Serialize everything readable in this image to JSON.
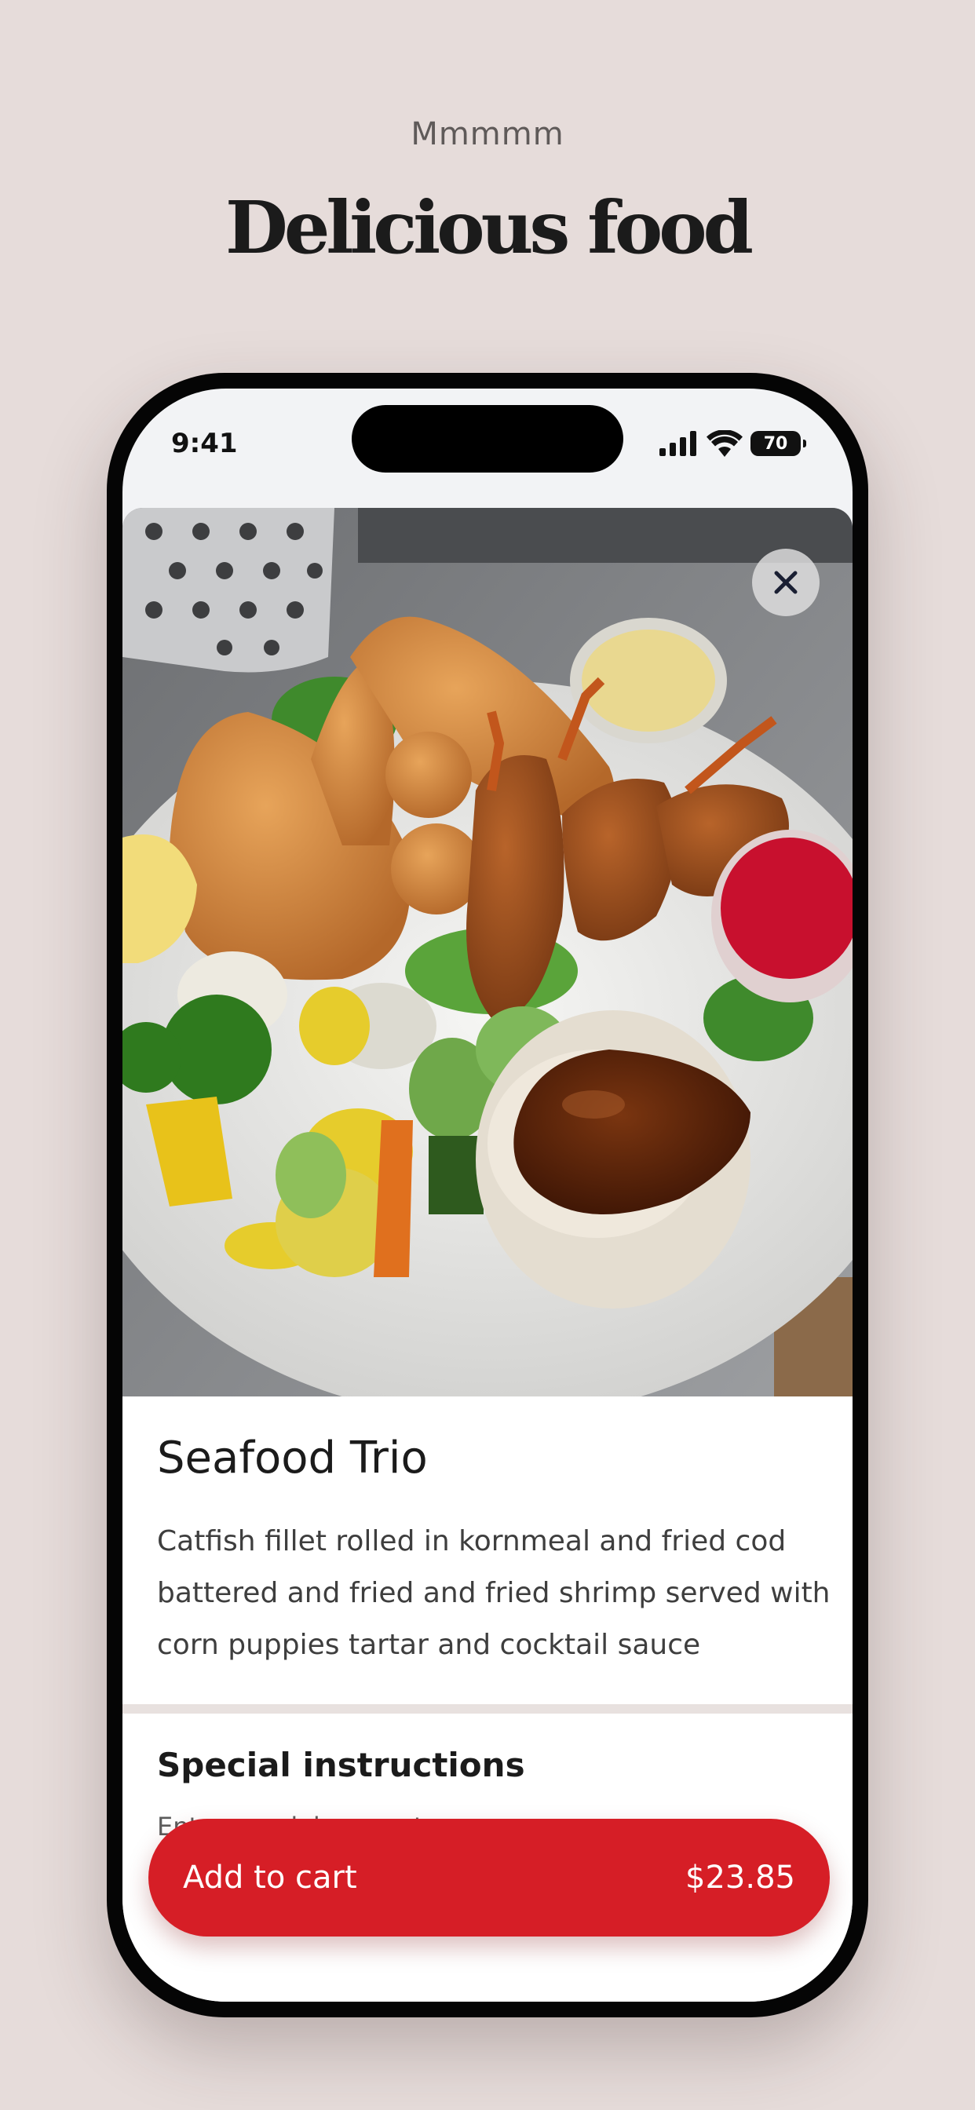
{
  "hero": {
    "eyebrow": "Mmmmm",
    "title": "Delicious food"
  },
  "status_bar": {
    "time": "9:41",
    "battery": "70",
    "icons": [
      "cellular-signal-icon",
      "wifi-icon",
      "battery-icon"
    ]
  },
  "item": {
    "image_alt": "Seafood Trio plate",
    "name": "Seafood Trio",
    "description": "Catfish fillet rolled in kornmeal and fried cod battered and fried and fried shrimp served with corn puppies tartar and cocktail sauce"
  },
  "instructions": {
    "title": "Special instructions",
    "placeholder": "Enter special requests"
  },
  "cart": {
    "label": "Add to cart",
    "price": "$23.85"
  },
  "colors": {
    "page_background": "#e6dcda",
    "accent": "#d61e26",
    "phone_frame": "#050505"
  }
}
